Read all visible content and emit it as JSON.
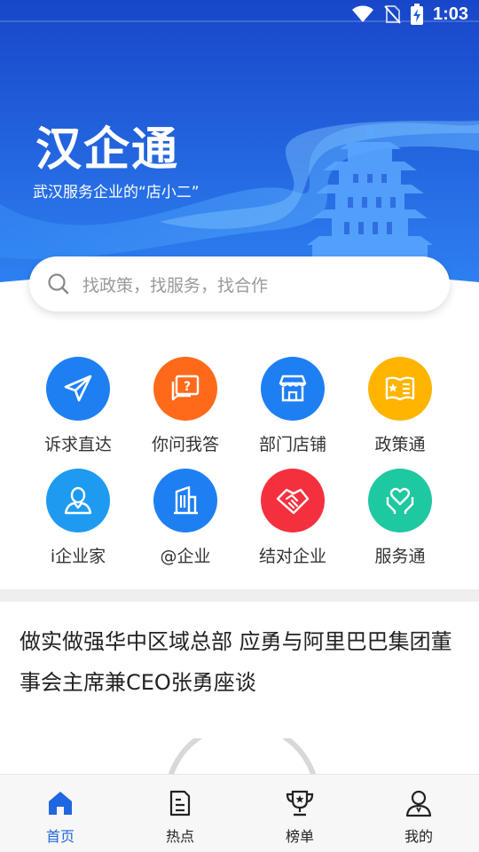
{
  "status_bar": {
    "time": "1:03",
    "icons": [
      "wifi-icon",
      "no-sim-icon",
      "battery-charging-icon"
    ]
  },
  "brand": {
    "title": "汉企通",
    "slogan": "武汉服务企业的“店小二”"
  },
  "search": {
    "placeholder": "找政策，找服务，找合作"
  },
  "services": [
    {
      "label": "诉求直达",
      "icon": "paper-plane-icon",
      "color": "#1e7ff3"
    },
    {
      "label": "你问我答",
      "icon": "question-chat-icon",
      "color": "#ff6a1a"
    },
    {
      "label": "部门店铺",
      "icon": "storefront-icon",
      "color": "#1e7ff3"
    },
    {
      "label": "政策通",
      "icon": "policy-book-icon",
      "color": "#ffb400"
    },
    {
      "label": "i企业家",
      "icon": "person-icon",
      "color": "#1e9bf0"
    },
    {
      "label": "@企业",
      "icon": "building-icon",
      "color": "#1e7ff3"
    },
    {
      "label": "结对企业",
      "icon": "handshake-icon",
      "color": "#f5303e"
    },
    {
      "label": "服务通",
      "icon": "heart-hands-icon",
      "color": "#1ec8a0"
    }
  ],
  "news": {
    "headline": "做实做强华中区域总部 应勇与阿里巴巴集团董事会主席兼CEO张勇座谈"
  },
  "tabs": [
    {
      "label": "首页",
      "icon": "home-icon",
      "active": true
    },
    {
      "label": "热点",
      "icon": "news-icon",
      "active": false
    },
    {
      "label": "榜单",
      "icon": "trophy-icon",
      "active": false
    },
    {
      "label": "我的",
      "icon": "profile-icon",
      "active": false
    }
  ],
  "colors": {
    "primary": "#1f67e0",
    "hero_top": "#1a4fd0",
    "hero_bottom": "#2f86f5"
  }
}
